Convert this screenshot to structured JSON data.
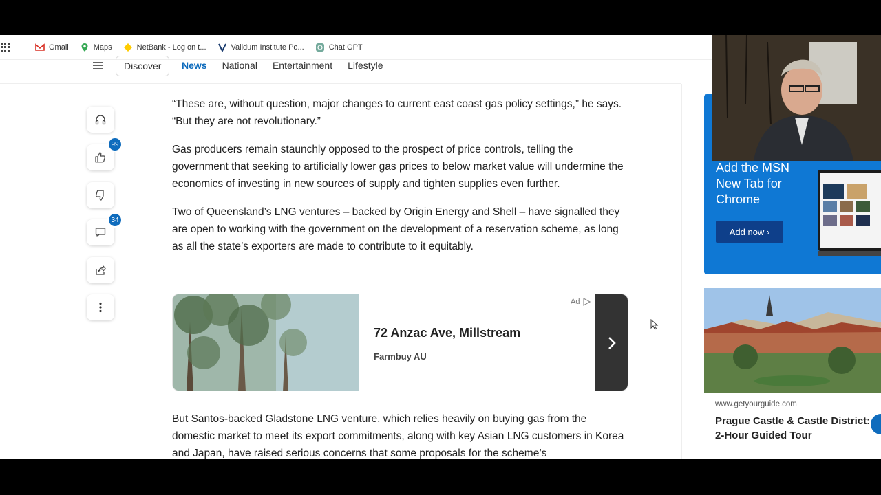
{
  "bookmarks": [
    {
      "label": "Gmail",
      "icon": "gmail-icon"
    },
    {
      "label": "Maps",
      "icon": "maps-pin-icon"
    },
    {
      "label": "NetBank - Log on t...",
      "icon": "netbank-icon"
    },
    {
      "label": "Validum Institute Po...",
      "icon": "validum-icon"
    },
    {
      "label": "Chat GPT",
      "icon": "chatgpt-icon"
    }
  ],
  "nav": {
    "discover": "Discover",
    "links": [
      "News",
      "National",
      "Entertainment",
      "Lifestyle"
    ],
    "active": "News"
  },
  "actions": {
    "likes_count": "99",
    "comments_count": "34"
  },
  "article": {
    "paragraphs": [
      "“These are, without question, major changes to current east coast gas policy settings,” he says. “But they are not revolutionary.”",
      "Gas producers remain staunchly opposed to the prospect of price controls, telling the government that seeking to artificially lower gas prices to below market value will undermine the economics of investing in new sources of supply and tighten supplies even further.",
      "Two of Queensland’s LNG ventures – backed by Origin Energy and Shell – have signalled they are open to working with the government on the development of a reservation scheme, as long as all the state’s exporters are made to contribute to it equitably.",
      "But Santos-backed Gladstone LNG venture, which relies heavily on buying gas from the domestic market to meet its export commitments, along with key Asian LNG customers in Korea and Japan, have raised serious concerns that some proposals for the scheme’s"
    ]
  },
  "ad": {
    "title": "72 Anzac Ave, Millstream",
    "subtitle": "Farmbuy AU",
    "tag": "Ad"
  },
  "msn_ad": {
    "title": "Add the MSN New Tab for Chrome",
    "button": "Add now ›",
    "color": "#0f78d4"
  },
  "travel": {
    "source": "www.getyourguide.com",
    "title": "Prague Castle & Castle District: 2-Hour Guided Tour"
  },
  "colors": {
    "accent": "#0f6cbd"
  }
}
